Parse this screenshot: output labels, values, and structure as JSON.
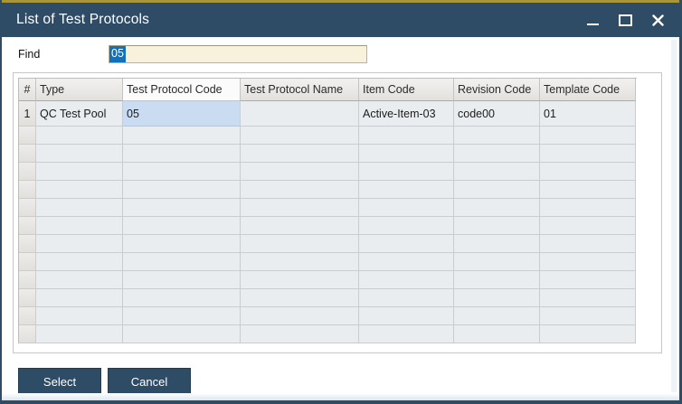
{
  "window": {
    "title": "List of Test Protocols",
    "controls": {
      "minimize": "minimize",
      "maximize": "maximize",
      "close": "close"
    }
  },
  "find": {
    "label": "Find",
    "value": "05",
    "value_selected": true
  },
  "table": {
    "columns": [
      "#",
      "Type",
      "Test Protocol Code",
      "Test Protocol Name",
      "Item Code",
      "Revision Code",
      "Template Code"
    ],
    "active_column_index": 2,
    "rows": [
      [
        "1",
        "QC Test Pool",
        "05",
        "",
        "Active-Item-03",
        "code00",
        "01"
      ]
    ],
    "selected_cell": {
      "row": 0,
      "col": 2
    },
    "empty_row_count": 12
  },
  "buttons": {
    "select_label": "Select",
    "cancel_label": "Cancel"
  },
  "colors": {
    "titlebar": "#2e4c66",
    "accent_gold": "#a9963a",
    "selection_blue": "#1371bc",
    "input_bg": "#f8f1dc",
    "selected_cell_bg": "#c9dcf2"
  }
}
